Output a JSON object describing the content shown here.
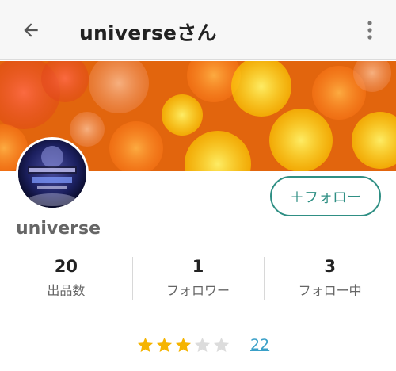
{
  "header": {
    "title": "universeさん",
    "back_icon": "arrow-left-icon",
    "more_icon": "more-vert-icon"
  },
  "cover": {
    "image": "orange-yellow-bokeh-lights"
  },
  "profile": {
    "avatar": "universe-logo-avatar",
    "username": "universe",
    "follow_label": "＋フォロー"
  },
  "stats": [
    {
      "value": "20",
      "label": "出品数"
    },
    {
      "value": "1",
      "label": "フォロワー"
    },
    {
      "value": "3",
      "label": "フォロー中"
    }
  ],
  "rating": {
    "stars": 3,
    "max_stars": 5,
    "review_count": "22"
  },
  "colors": {
    "accent": "#2f8f84",
    "link": "#3aa0c8",
    "star_filled": "#f5b400",
    "star_empty": "#dcdcdc"
  }
}
